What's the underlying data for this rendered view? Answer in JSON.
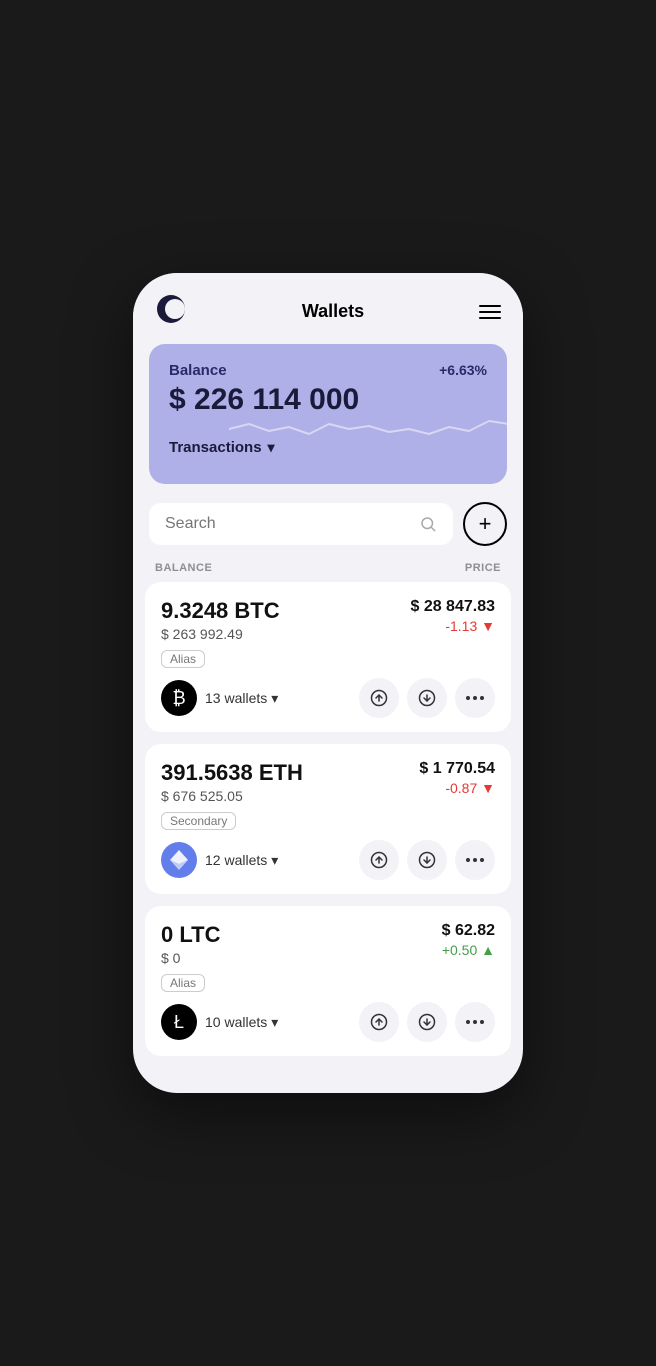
{
  "header": {
    "title": "Wallets",
    "menu_label": "menu"
  },
  "balance_card": {
    "label": "Balance",
    "percent": "+6.63%",
    "amount": "$ 226 114 000",
    "transactions_label": "Transactions"
  },
  "search": {
    "placeholder": "Search"
  },
  "columns": {
    "balance": "BALANCE",
    "price": "PRICE"
  },
  "coins": [
    {
      "id": "btc",
      "amount": "9.3248 BTC",
      "usd": "$ 263 992.49",
      "alias": "Alias",
      "wallets": "13 wallets",
      "price": "$ 28 847.83",
      "change": "-1.13 ▼",
      "change_type": "negative",
      "symbol": "₿"
    },
    {
      "id": "eth",
      "amount": "391.5638 ETH",
      "usd": "$ 676 525.05",
      "alias": "Secondary",
      "wallets": "12 wallets",
      "price": "$ 1 770.54",
      "change": "-0.87 ▼",
      "change_type": "negative",
      "symbol": "⬡"
    },
    {
      "id": "ltc",
      "amount": "0 LTC",
      "usd": "$ 0",
      "alias": "Alias",
      "wallets": "10 wallets",
      "price": "$ 62.82",
      "change": "+0.50 ▲",
      "change_type": "positive",
      "symbol": "Ł"
    }
  ]
}
